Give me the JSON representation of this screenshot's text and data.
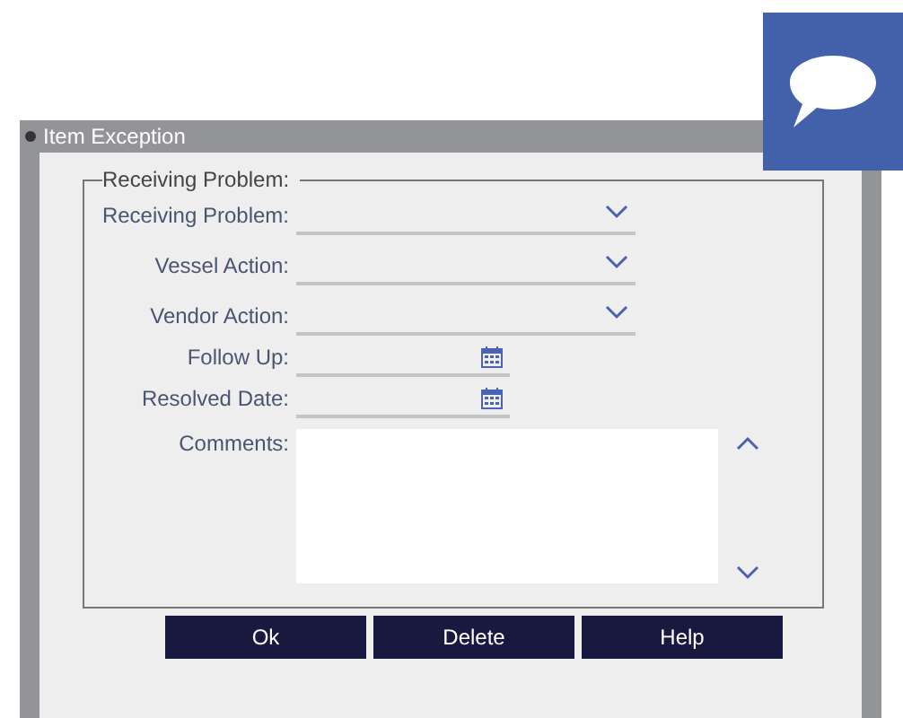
{
  "window": {
    "title": "Item Exception"
  },
  "fieldset": {
    "legend": "Receiving Problem:"
  },
  "fields": [
    {
      "kind": "select",
      "label": "Receiving Problem:"
    },
    {
      "kind": "select",
      "label": "Vessel Action:"
    },
    {
      "kind": "select",
      "label": "Vendor Action:"
    },
    {
      "kind": "date",
      "label": "Follow Up:"
    },
    {
      "kind": "date",
      "label": "Resolved Date:"
    },
    {
      "kind": "textarea",
      "label": "Comments:"
    }
  ],
  "buttons": [
    "Ok",
    "Delete",
    "Help"
  ]
}
